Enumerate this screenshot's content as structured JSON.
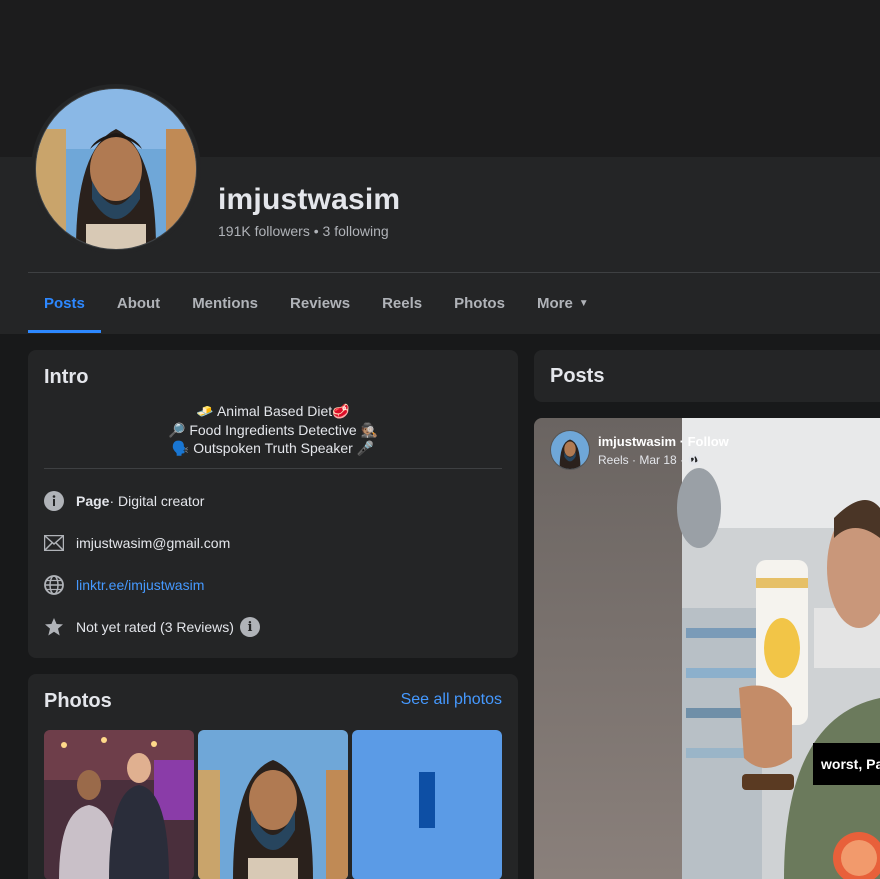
{
  "profile": {
    "name": "imjustwasim",
    "followers": "191K followers",
    "separator": " • ",
    "following": "3 following"
  },
  "tabs": [
    {
      "label": "Posts",
      "active": true
    },
    {
      "label": "About",
      "active": false
    },
    {
      "label": "Mentions",
      "active": false
    },
    {
      "label": "Reviews",
      "active": false
    },
    {
      "label": "Reels",
      "active": false
    },
    {
      "label": "Photos",
      "active": false
    },
    {
      "label": "More",
      "active": false,
      "icon": "caret-down-icon"
    }
  ],
  "intro": {
    "title": "Intro",
    "bio": [
      "🧈 Animal Based Diet🥩",
      "🔎 Food Ingredients Detective 🕵🏽",
      "🗣️ Outspoken Truth Speaker 🎤"
    ],
    "page_label": "Page",
    "page_category": " · Digital creator",
    "email": "imjustwasim@gmail.com",
    "website": "linktr.ee/imjustwasim",
    "rating": "Not yet rated (3 Reviews)",
    "info_glyph": "i"
  },
  "photos": {
    "title": "Photos",
    "see_all": "See all photos"
  },
  "posts": {
    "title": "Posts",
    "post": {
      "author": "imjustwasim",
      "follow": " · Follow",
      "meta": "Reels · Mar 18 ·",
      "caption": "worst, Pa"
    }
  },
  "colors": {
    "accent": "#2d88ff",
    "link": "#4599ff",
    "card": "#242526",
    "background": "#18191a"
  }
}
